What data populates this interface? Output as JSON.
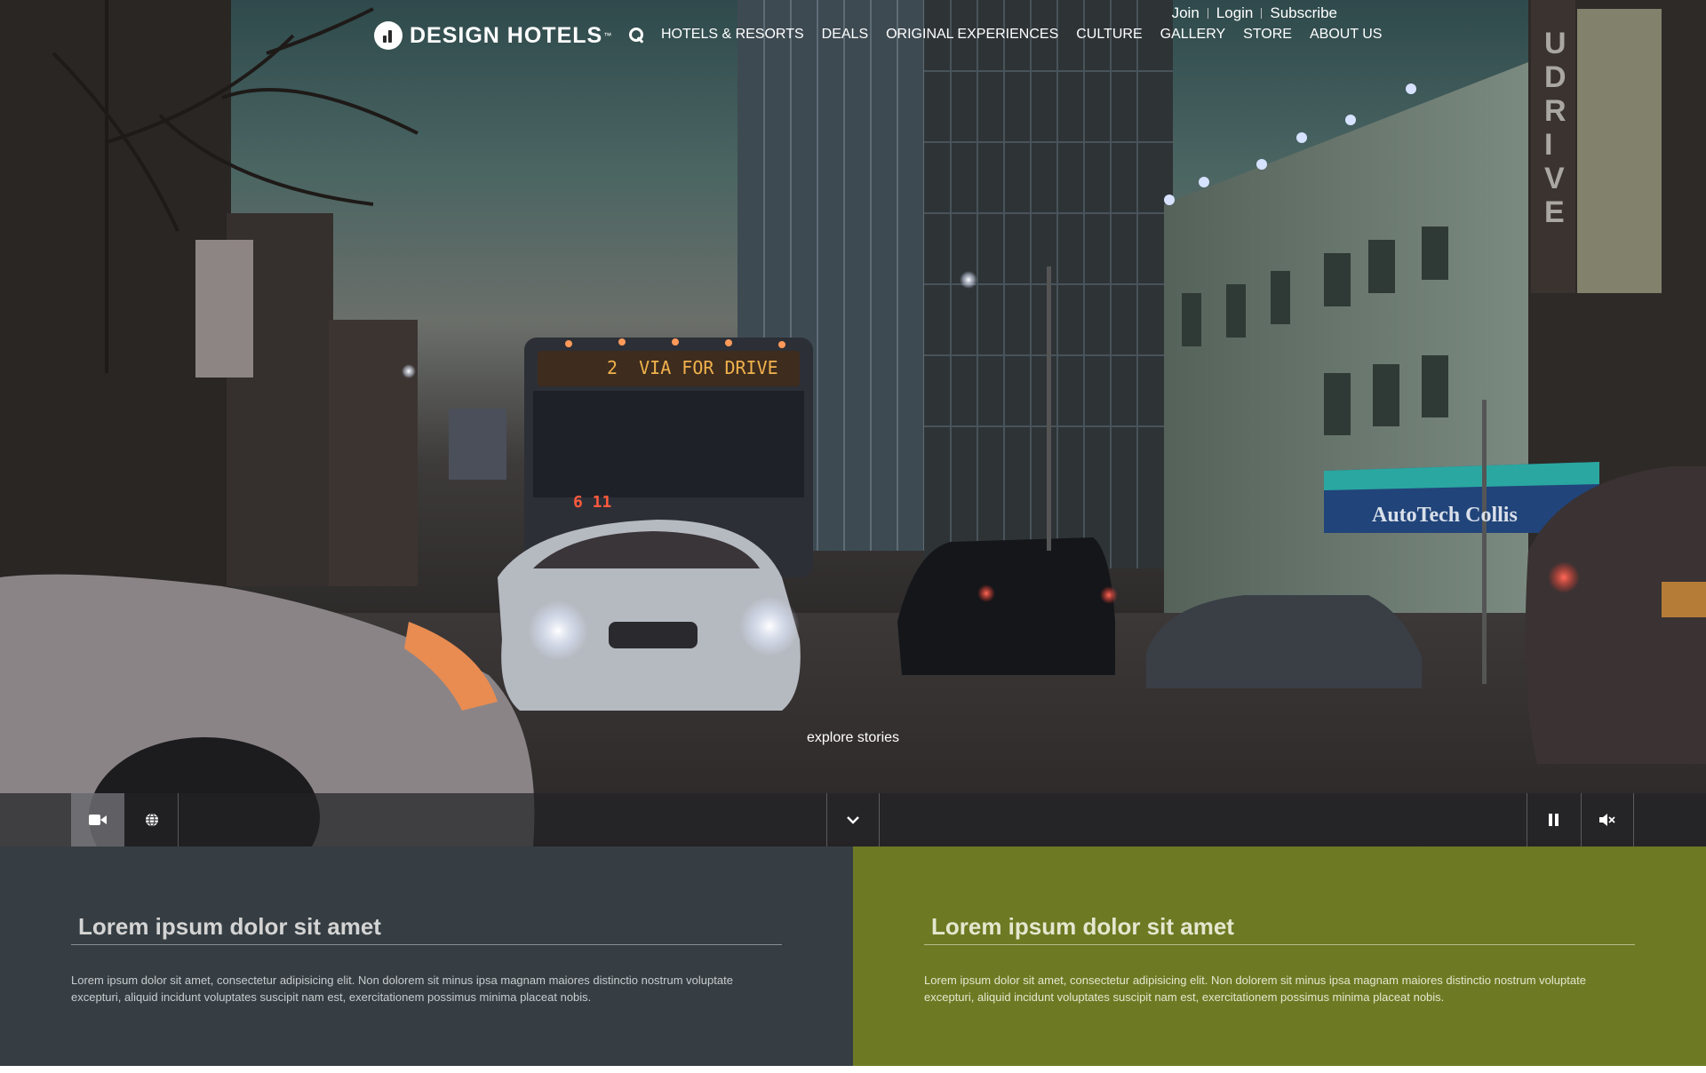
{
  "brand": {
    "name": "DESIGN HOTELS",
    "reg": "™"
  },
  "utility_nav": {
    "join": "Join",
    "login": "Login",
    "subscribe": "Subscribe"
  },
  "main_nav": {
    "items": [
      "HOTELS & RESORTS",
      "DEALS",
      "ORIGINAL EXPERIENCES",
      "CULTURE",
      "GALLERY",
      "STORE",
      "ABOUT US"
    ]
  },
  "hero": {
    "explore_label": "explore stories",
    "scene_text": {
      "bus_sign": "2  VIA FOR DRIVE",
      "bus_number": "6 11",
      "storefront": "AutoTech Collis",
      "vertical_sign": "UDRIVE"
    }
  },
  "controls": {
    "icons": [
      "video-camera-icon",
      "globe-icon",
      "chevron-down-icon",
      "pause-icon",
      "mute-icon"
    ]
  },
  "cards": [
    {
      "title": "Lorem ipsum dolor sit amet",
      "body": "Lorem ipsum dolor sit amet, consectetur adipisicing elit. Non dolorem sit minus ipsa magnam maiores distinctio nostrum voluptate excepturi, aliquid incidunt voluptates suscipit nam est, exercitationem possimus minima placeat nobis.",
      "color": "#363e43"
    },
    {
      "title": "Lorem ipsum dolor sit amet",
      "body": "Lorem ipsum dolor sit amet, consectetur adipisicing elit. Non dolorem sit minus ipsa magnam maiores distinctio nostrum voluptate excepturi, aliquid incidunt voluptates suscipit nam est, exercitationem possimus minima placeat nobis.",
      "color": "#6d7a23"
    }
  ]
}
